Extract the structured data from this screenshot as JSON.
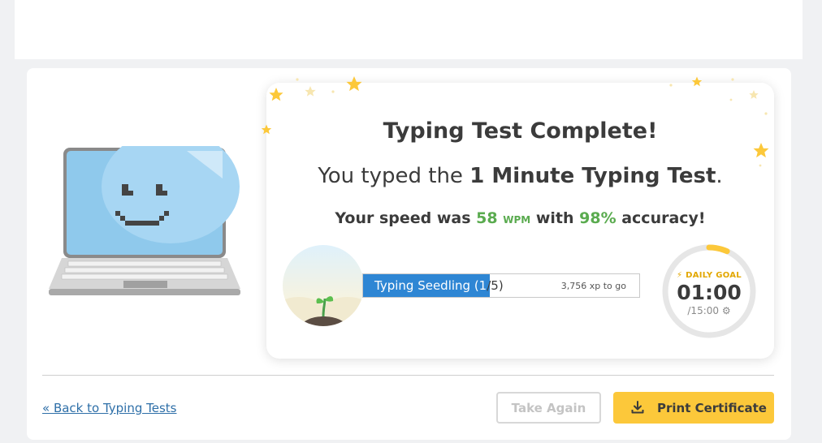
{
  "result": {
    "title": "Typing Test Complete!",
    "subtitle_prefix": "You typed the ",
    "test_name": "1 Minute Typing Test",
    "subtitle_suffix": ".",
    "speed_prefix": "Your speed was ",
    "wpm": "58",
    "wpm_unit": "WPM",
    "speed_mid": " with ",
    "accuracy": "98%",
    "speed_suffix": " accuracy!"
  },
  "level": {
    "name": "Typing Seedling (1",
    "name_tail": "/5)",
    "xp_to_go": "3,756 xp to go",
    "progress_fraction": 0.46,
    "avatar_icon": "seedling-icon"
  },
  "daily_goal": {
    "label": "DAILY GOAL",
    "time": "01:00",
    "target": "/15:00",
    "progress_fraction": 0.067,
    "color": "#fcc83a"
  },
  "footer": {
    "back_link": "« Back to Typing Tests",
    "take_again": "Take Again",
    "print_certificate": "Print Certificate"
  },
  "colors": {
    "accent_blue": "#2e86d4",
    "accent_green": "#5aab4f",
    "accent_yellow": "#fcc83a"
  }
}
